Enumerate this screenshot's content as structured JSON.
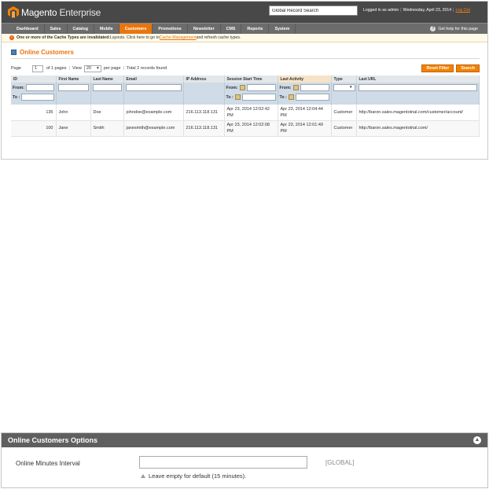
{
  "header": {
    "logo_brand": "Magento",
    "logo_edition": "Enterprise",
    "search_value": "Global Record Search",
    "logged_in": "Logged in as admin",
    "date": "Wednesday, April 23, 2014",
    "logout": "Log Out"
  },
  "nav": {
    "items": [
      "Dashboard",
      "Sales",
      "Catalog",
      "Mobile",
      "Customers",
      "Promotions",
      "Newsletter",
      "CMS",
      "Reports",
      "System"
    ],
    "active": "Customers",
    "help": "Get help for this page"
  },
  "notice": {
    "lead": "One or more of the Cache Types are invalidated:",
    "text": " Layouts. Click here to go to ",
    "link": "Cache Management",
    "tail": " and refresh cache types."
  },
  "page": {
    "title": "Online Customers"
  },
  "pager": {
    "page_label": "Page",
    "page_value": "1",
    "of_pages": "of 1 pages",
    "view_label": "View",
    "per_page_value": "20",
    "per_page_label": "per page",
    "total": "Total 2 records found",
    "reset_label": "Reset Filter",
    "search_label": "Search"
  },
  "grid": {
    "columns": [
      "ID",
      "First Name",
      "Last Name",
      "Email",
      "IP Address",
      "Session Start Time",
      "Last Activity",
      "Type",
      "Last URL"
    ],
    "filter": {
      "from": "From:",
      "to": "To :"
    },
    "rows": [
      {
        "id": "135",
        "first": "John",
        "last": "Doe",
        "email": "johndoe@example.com",
        "ip": "216.113.118.131",
        "start": "Apr 23, 2014 12:02:42 PM",
        "activity": "Apr 23, 2014 12:04:44 PM",
        "type": "Customer",
        "url": "http://baron.sales.magentotrial.com/customer/account/"
      },
      {
        "id": "100",
        "first": "Jane",
        "last": "Smith",
        "email": "janesmith@example.com",
        "ip": "216.113.118.131",
        "start": "Apr 23, 2014 12:02:08 PM",
        "activity": "Apr 23, 2014 12:01:49 PM",
        "type": "Customer",
        "url": "http://baron.sales.magentotrial.com/"
      }
    ]
  },
  "options": {
    "title": "Online Customers Options",
    "field_label": "Online Minutes Interval",
    "field_value": "",
    "scope": "[GLOBAL]",
    "note": "Leave empty for default (15 minutes)."
  },
  "colors": {
    "accent": "#e8760f",
    "header_bg": "#484848",
    "nav_bg": "#6c6c6c",
    "options_head_bg": "#5f5f5f"
  }
}
